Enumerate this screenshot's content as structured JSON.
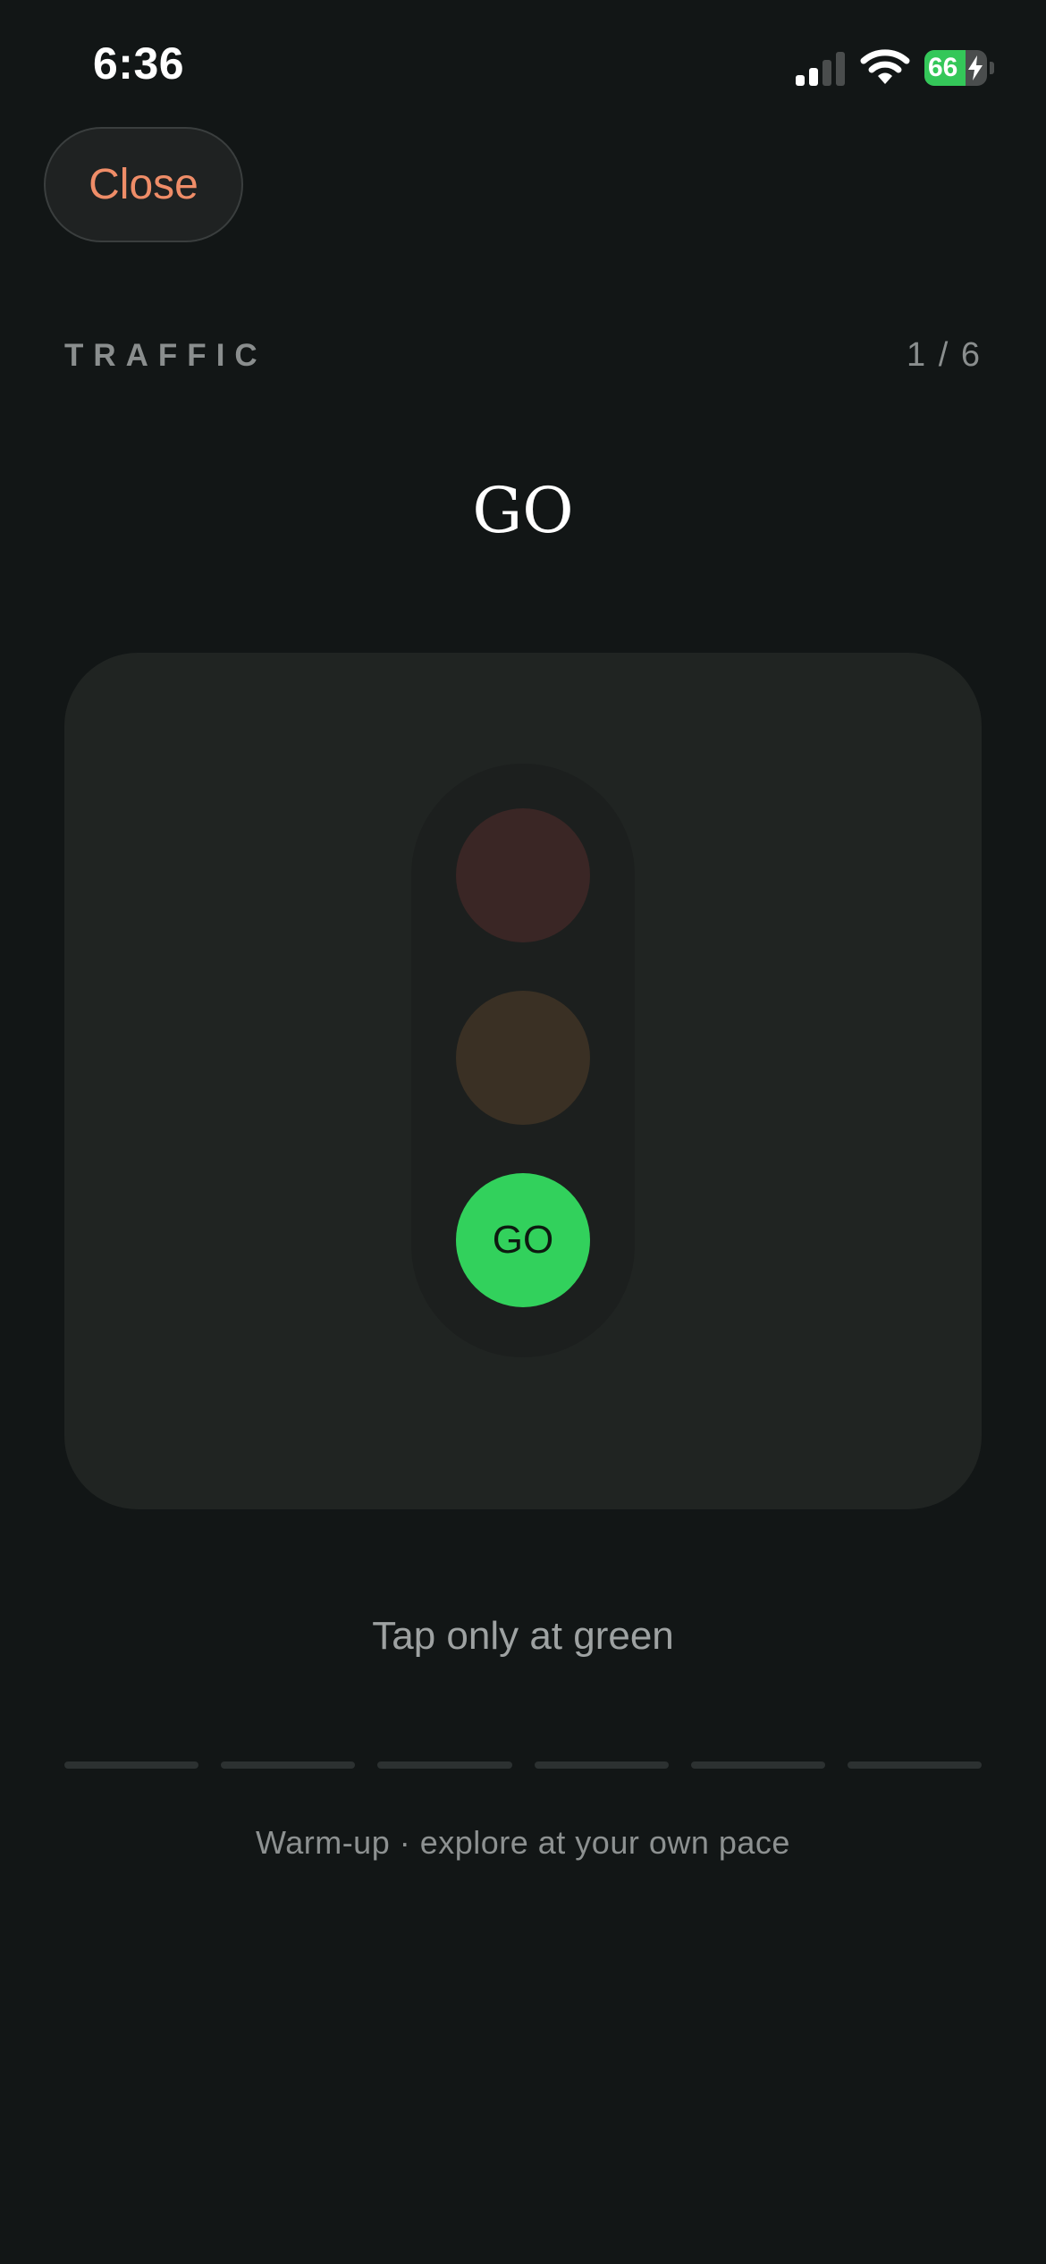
{
  "status_bar": {
    "time": "6:36",
    "battery_percent": "66",
    "battery_level": 0.66,
    "icons": [
      "cellular-signal-icon",
      "wifi-icon",
      "battery-charging-icon"
    ]
  },
  "header": {
    "close_label": "Close",
    "section_label": "TRAFFIC",
    "page_counter": "1 / 6"
  },
  "main": {
    "title": "GO",
    "traffic_light": {
      "lights": [
        {
          "name": "red",
          "label": "",
          "active": false,
          "color": "#3a2625"
        },
        {
          "name": "yellow",
          "label": "",
          "active": false,
          "color": "#3a3024"
        },
        {
          "name": "green",
          "label": "GO",
          "active": true,
          "color": "#32d15c"
        }
      ]
    },
    "instruction": "Tap only at green"
  },
  "progress": {
    "total_steps": 6,
    "completed_steps": 0
  },
  "footer": {
    "note": "Warm-up · explore at your own pace"
  },
  "colors": {
    "background": "#121616",
    "card": "#202422",
    "accent_close": "#ef8d68",
    "go_green": "#32d15c"
  }
}
